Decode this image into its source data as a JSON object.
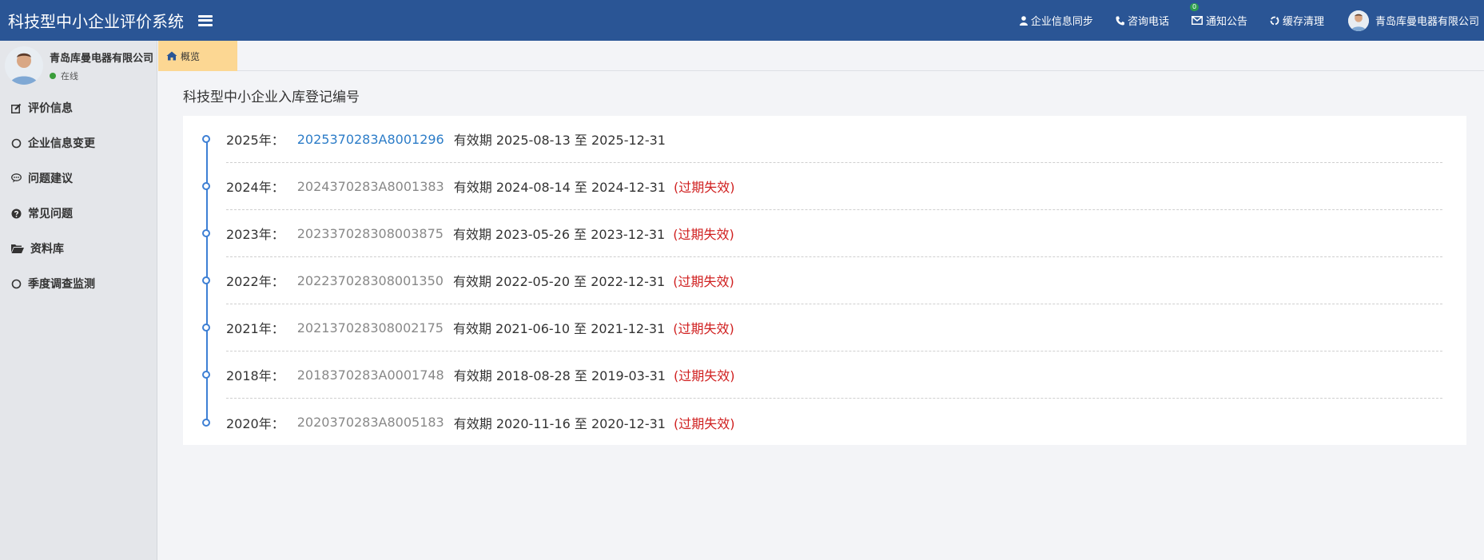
{
  "header": {
    "title": "科技型中小企业评价系统",
    "items": [
      {
        "label": "企业信息同步",
        "icon": "user-icon"
      },
      {
        "label": "咨询电话",
        "icon": "phone-icon"
      },
      {
        "label": "通知公告",
        "icon": "envelope-icon",
        "badge": "0"
      },
      {
        "label": "缓存清理",
        "icon": "recycle-icon"
      }
    ],
    "user": "青岛库曼电器有限公司"
  },
  "sidebar": {
    "user_name": "青岛库曼电器有限公司",
    "status": "在线",
    "items": [
      {
        "label": "评价信息",
        "icon": "edit-icon"
      },
      {
        "label": "企业信息变更",
        "icon": "circle-icon"
      },
      {
        "label": "问题建议",
        "icon": "comment-icon"
      },
      {
        "label": "常见问题",
        "icon": "question-icon"
      },
      {
        "label": "资料库",
        "icon": "folder-open-icon"
      },
      {
        "label": "季度调查监测",
        "icon": "circle-icon"
      }
    ]
  },
  "tabs": [
    {
      "label": "概览",
      "icon": "home-icon"
    }
  ],
  "main": {
    "title": "科技型中小企业入库登记编号",
    "records": [
      {
        "year": "2025年：",
        "code": "2025370283A8001296",
        "validity": "有效期 2025-08-13 至 2025-12-31",
        "status": ""
      },
      {
        "year": "2024年：",
        "code": "2024370283A8001383",
        "validity": "有效期 2024-08-14 至 2024-12-31",
        "status": "(过期失效)"
      },
      {
        "year": "2023年：",
        "code": "202337028308003875",
        "validity": "有效期 2023-05-26 至 2023-12-31",
        "status": "(过期失效)"
      },
      {
        "year": "2022年：",
        "code": "202237028308001350",
        "validity": "有效期 2022-05-20 至 2022-12-31",
        "status": "(过期失效)"
      },
      {
        "year": "2021年：",
        "code": "202137028308002175",
        "validity": "有效期 2021-06-10 至 2021-12-31",
        "status": "(过期失效)"
      },
      {
        "year": "2018年：",
        "code": "2018370283A0001748",
        "validity": "有效期 2018-08-28 至 2019-03-31",
        "status": "(过期失效)"
      },
      {
        "year": "2020年：",
        "code": "2020370283A8005183",
        "validity": "有效期 2020-11-16 至 2020-12-31",
        "status": "(过期失效)"
      }
    ]
  },
  "colors": {
    "header_bg": "#2a5595",
    "link": "#2d7dc8",
    "expired": "#d02020",
    "tab_active": "#fcd793"
  }
}
